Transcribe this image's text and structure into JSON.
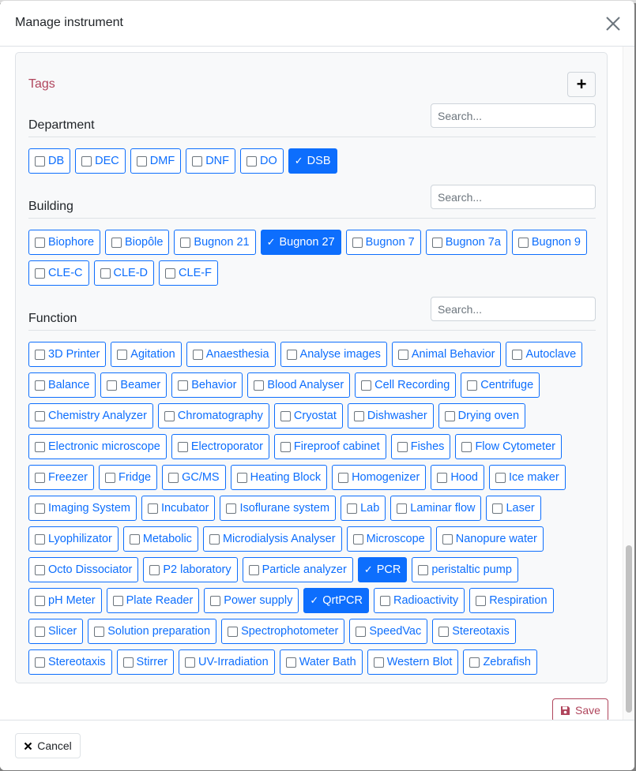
{
  "modal": {
    "title": "Manage instrument",
    "tags_title": "Tags",
    "add_label": "+",
    "save_label": "Save",
    "cancel_label": "Cancel",
    "accent_color": "#0d6efd",
    "danger_color": "#b0455c"
  },
  "sections": [
    {
      "label": "Department",
      "search_placeholder": "Search...",
      "items": [
        {
          "label": "DB",
          "checked": false
        },
        {
          "label": "DEC",
          "checked": false
        },
        {
          "label": "DMF",
          "checked": false
        },
        {
          "label": "DNF",
          "checked": false
        },
        {
          "label": "DO",
          "checked": false
        },
        {
          "label": "DSB",
          "checked": true
        }
      ]
    },
    {
      "label": "Building",
      "search_placeholder": "Search...",
      "items": [
        {
          "label": "Biophore",
          "checked": false
        },
        {
          "label": "Biopôle",
          "checked": false
        },
        {
          "label": "Bugnon 21",
          "checked": false
        },
        {
          "label": "Bugnon 27",
          "checked": true
        },
        {
          "label": "Bugnon 7",
          "checked": false
        },
        {
          "label": "Bugnon 7a",
          "checked": false
        },
        {
          "label": "Bugnon 9",
          "checked": false
        },
        {
          "label": "CLE-C",
          "checked": false
        },
        {
          "label": "CLE-D",
          "checked": false
        },
        {
          "label": "CLE-F",
          "checked": false
        }
      ]
    },
    {
      "label": "Function",
      "search_placeholder": "Search...",
      "items": [
        {
          "label": "3D Printer",
          "checked": false
        },
        {
          "label": "Agitation",
          "checked": false
        },
        {
          "label": "Anaesthesia",
          "checked": false
        },
        {
          "label": "Analyse images",
          "checked": false
        },
        {
          "label": "Animal Behavior",
          "checked": false
        },
        {
          "label": "Autoclave",
          "checked": false
        },
        {
          "label": "Balance",
          "checked": false
        },
        {
          "label": "Beamer",
          "checked": false
        },
        {
          "label": "Behavior",
          "checked": false
        },
        {
          "label": "Blood Analyser",
          "checked": false
        },
        {
          "label": "Cell Recording",
          "checked": false
        },
        {
          "label": "Centrifuge",
          "checked": false
        },
        {
          "label": "Chemistry Analyzer",
          "checked": false
        },
        {
          "label": "Chromatography",
          "checked": false
        },
        {
          "label": "Cryostat",
          "checked": false
        },
        {
          "label": "Dishwasher",
          "checked": false
        },
        {
          "label": "Drying oven",
          "checked": false
        },
        {
          "label": "Electronic microscope",
          "checked": false
        },
        {
          "label": "Electroporator",
          "checked": false
        },
        {
          "label": "Fireproof cabinet",
          "checked": false
        },
        {
          "label": "Fishes",
          "checked": false
        },
        {
          "label": "Flow Cytometer",
          "checked": false
        },
        {
          "label": "Freezer",
          "checked": false
        },
        {
          "label": "Fridge",
          "checked": false
        },
        {
          "label": "GC/MS",
          "checked": false
        },
        {
          "label": "Heating Block",
          "checked": false
        },
        {
          "label": "Homogenizer",
          "checked": false
        },
        {
          "label": "Hood",
          "checked": false
        },
        {
          "label": "Ice maker",
          "checked": false
        },
        {
          "label": "Imaging System",
          "checked": false
        },
        {
          "label": "Incubator",
          "checked": false
        },
        {
          "label": "Isoflurane system",
          "checked": false
        },
        {
          "label": "Lab",
          "checked": false
        },
        {
          "label": "Laminar flow",
          "checked": false
        },
        {
          "label": "Laser",
          "checked": false
        },
        {
          "label": "Lyophilizator",
          "checked": false
        },
        {
          "label": "Metabolic",
          "checked": false
        },
        {
          "label": "Microdialysis Analyser",
          "checked": false
        },
        {
          "label": "Microscope",
          "checked": false
        },
        {
          "label": "Nanopure water",
          "checked": false
        },
        {
          "label": "Octo Dissociator",
          "checked": false
        },
        {
          "label": "P2 laboratory",
          "checked": false
        },
        {
          "label": "Particle analyzer",
          "checked": false
        },
        {
          "label": "PCR",
          "checked": true
        },
        {
          "label": "peristaltic pump",
          "checked": false
        },
        {
          "label": "pH Meter",
          "checked": false
        },
        {
          "label": "Plate Reader",
          "checked": false
        },
        {
          "label": "Power supply",
          "checked": false
        },
        {
          "label": "QrtPCR",
          "checked": true
        },
        {
          "label": "Radioactivity",
          "checked": false
        },
        {
          "label": "Respiration",
          "checked": false
        },
        {
          "label": "Slicer",
          "checked": false
        },
        {
          "label": "Solution preparation",
          "checked": false
        },
        {
          "label": "Spectrophotometer",
          "checked": false
        },
        {
          "label": "SpeedVac",
          "checked": false
        },
        {
          "label": "Stereotaxis",
          "checked": false
        },
        {
          "label": "Stereotaxis",
          "checked": false
        },
        {
          "label": "Stirrer",
          "checked": false
        },
        {
          "label": "UV-Irradiation",
          "checked": false
        },
        {
          "label": "Water Bath",
          "checked": false
        },
        {
          "label": "Western Blot",
          "checked": false
        },
        {
          "label": "Zebrafish",
          "checked": false
        }
      ]
    }
  ]
}
